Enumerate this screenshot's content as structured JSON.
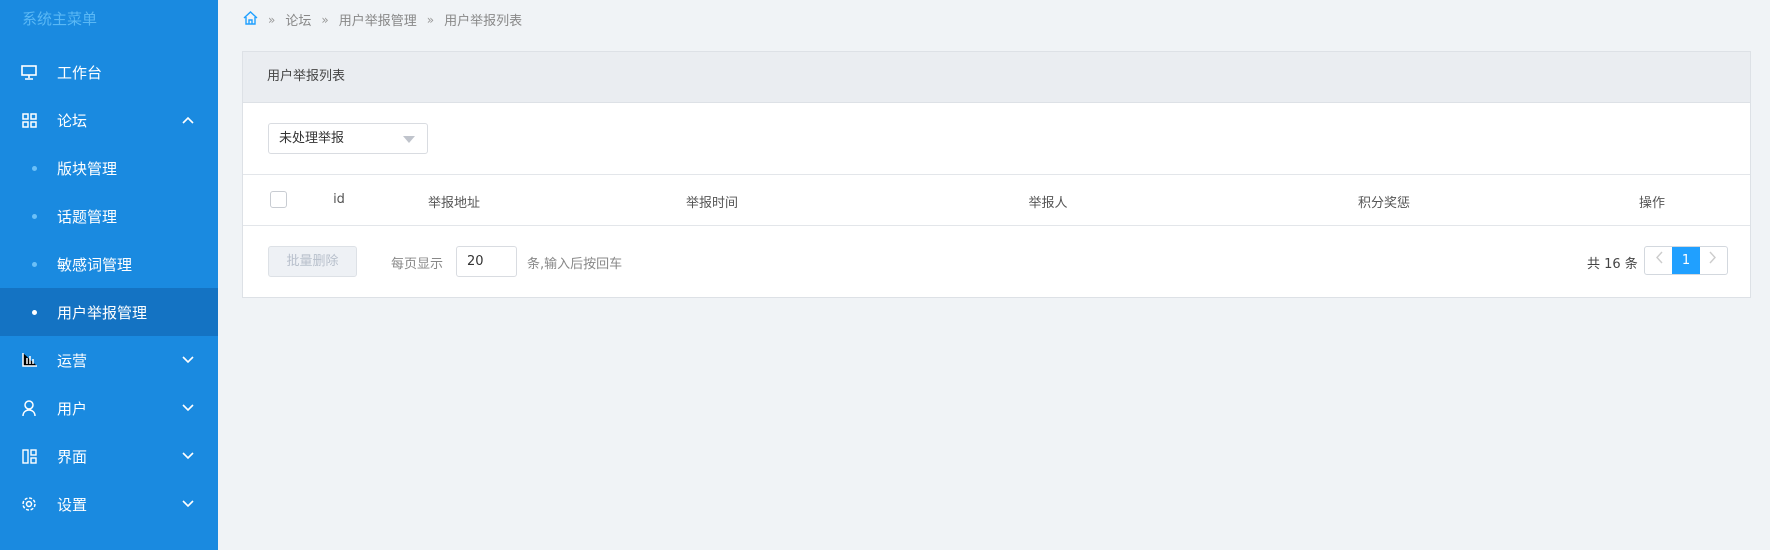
{
  "sidebar": {
    "title": "系统主菜单",
    "items": [
      {
        "label": "工作台",
        "icon": "monitor-icon"
      },
      {
        "label": "论坛",
        "icon": "grid-icon",
        "expanded": true,
        "children": [
          "版块管理",
          "话题管理",
          "敏感词管理",
          "用户举报管理"
        ],
        "active_child": "用户举报管理"
      },
      {
        "label": "运营",
        "icon": "bar-chart-icon"
      },
      {
        "label": "用户",
        "icon": "user-icon"
      },
      {
        "label": "界面",
        "icon": "layout-icon"
      },
      {
        "label": "设置",
        "icon": "gear-icon"
      }
    ]
  },
  "breadcrumb": [
    "论坛",
    "用户举报管理",
    "用户举报列表"
  ],
  "card": {
    "title": "用户举报列表",
    "filter_value": "未处理举报",
    "columns": [
      "id",
      "举报地址",
      "举报时间",
      "举报人",
      "积分奖惩",
      "操作"
    ],
    "batch_delete": "批量删除",
    "per_page_label": "每页显示",
    "per_page_value": "20",
    "per_page_hint": "条,输入后按回车",
    "total": "共 16 条",
    "current_page": "1"
  },
  "colors": {
    "sidebar": "#1a8ae0",
    "active": "#1473c3",
    "accent": "#20a0ff"
  }
}
